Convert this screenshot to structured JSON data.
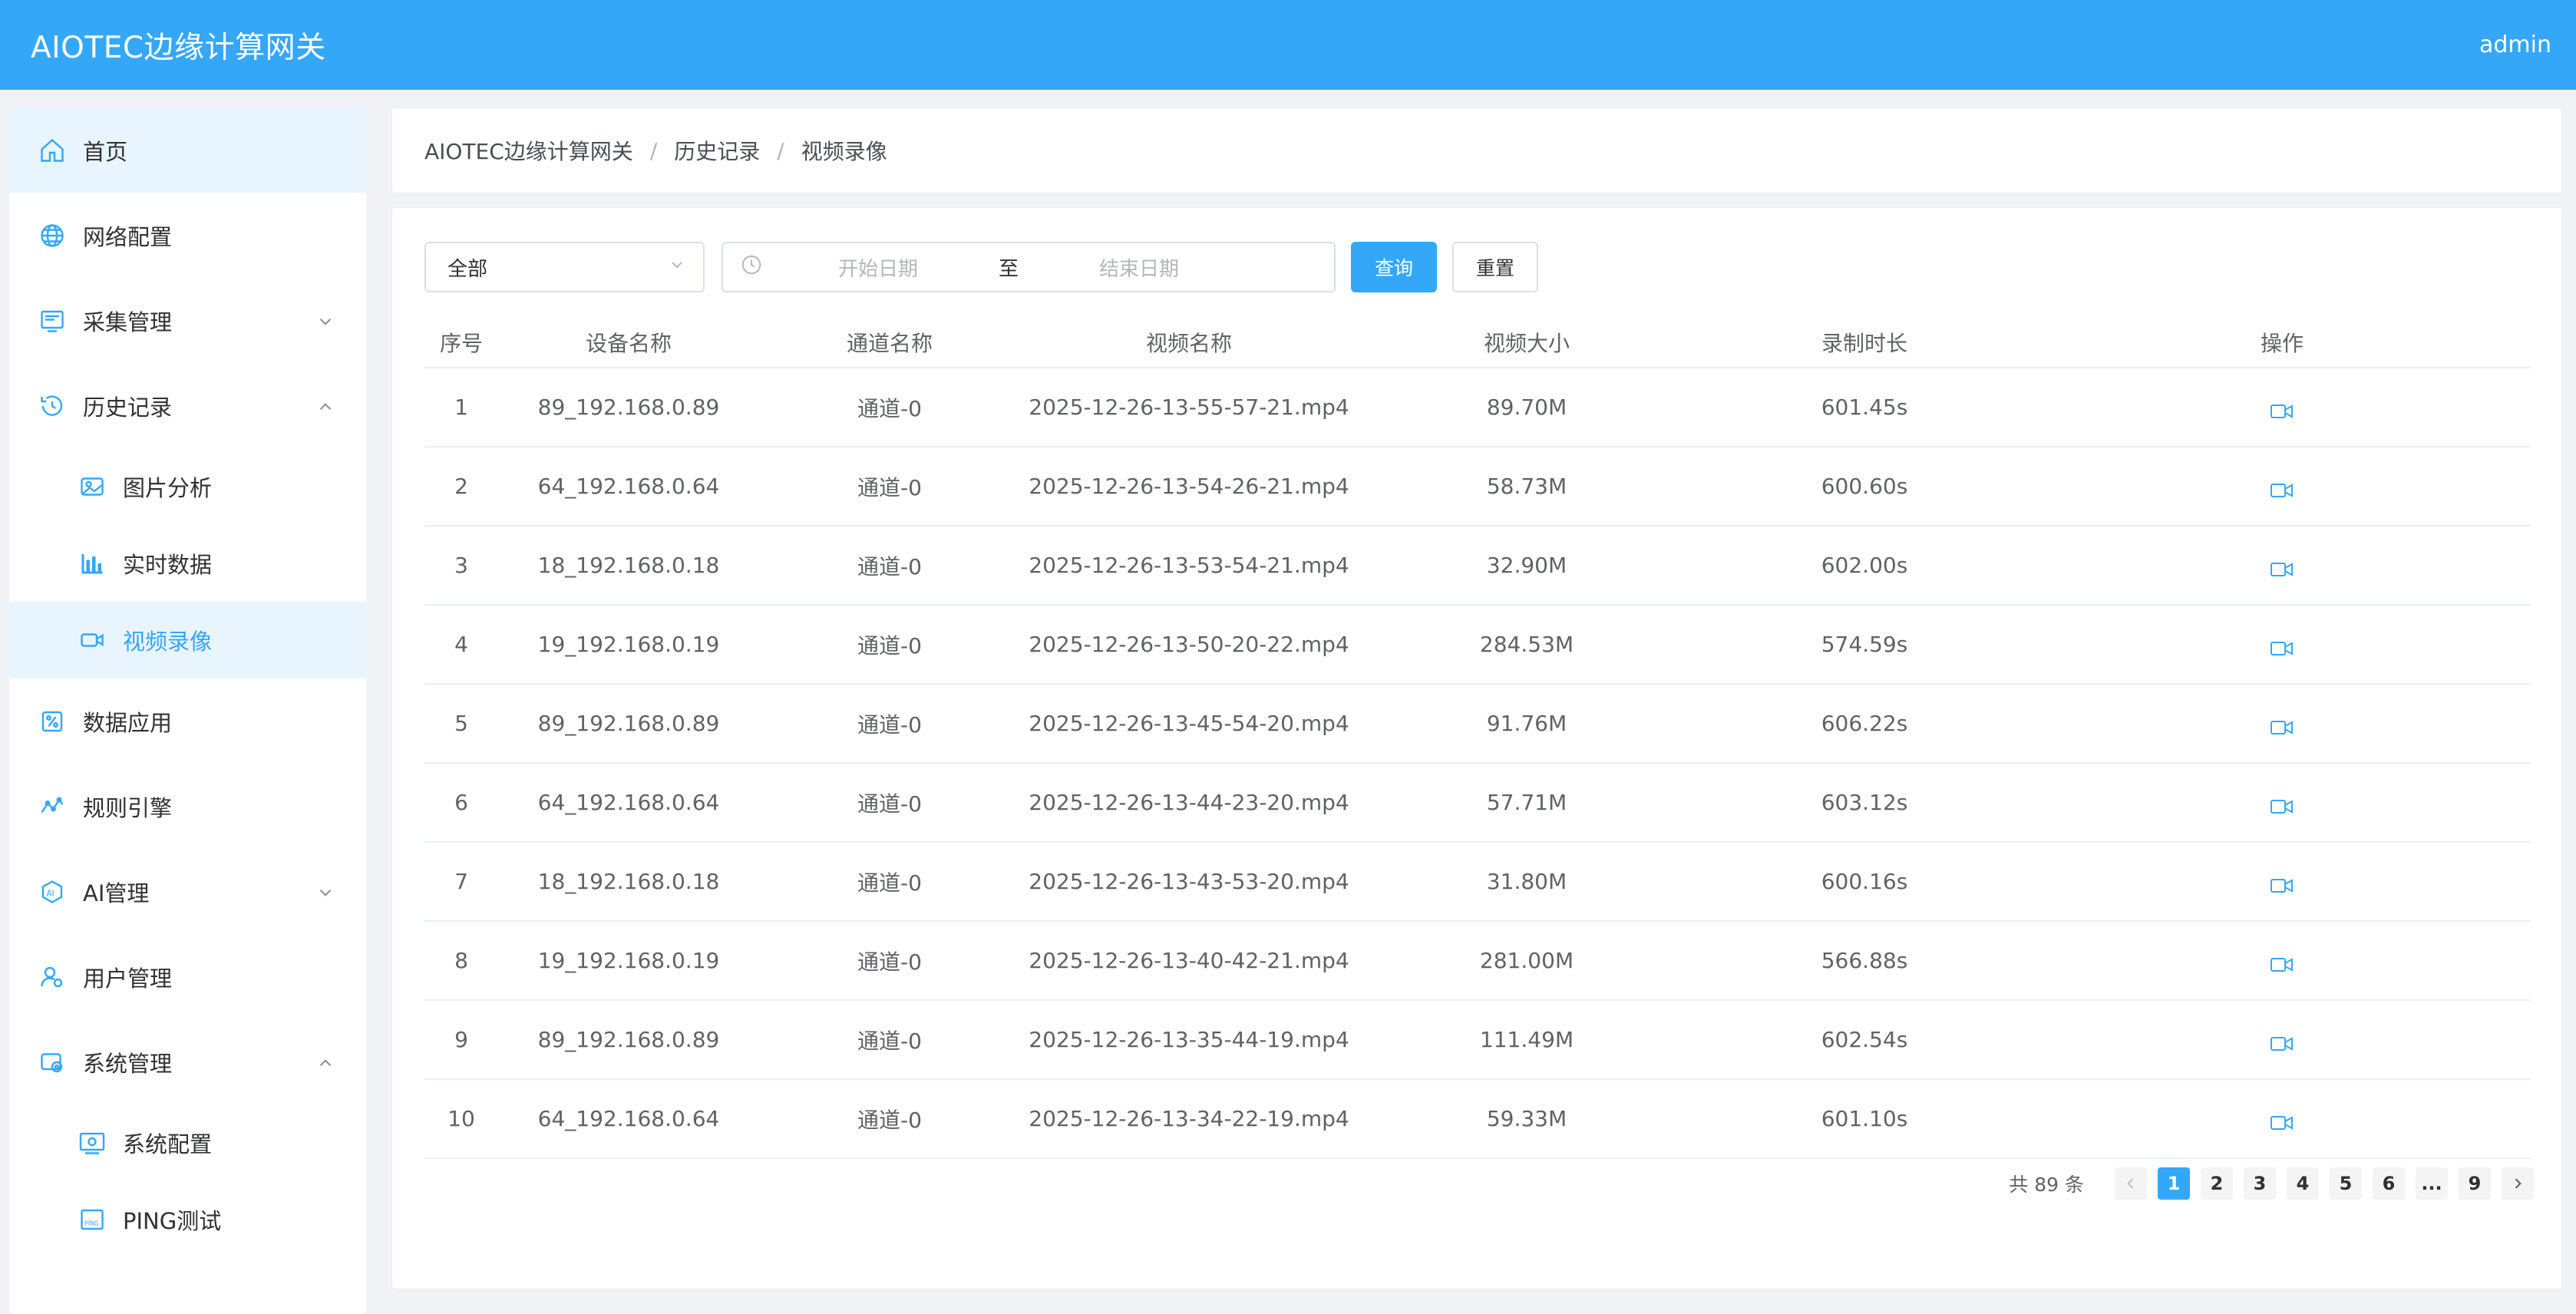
{
  "header": {
    "title": "AIOTEC边缘计算网关",
    "user": "admin"
  },
  "sidebar": {
    "items": [
      {
        "label": "首页",
        "icon": "home-icon"
      },
      {
        "label": "网络配置",
        "icon": "globe-icon"
      },
      {
        "label": "采集管理",
        "icon": "collect-icon"
      },
      {
        "label": "历史记录",
        "icon": "history-icon"
      },
      {
        "label": "图片分析",
        "icon": "image-icon"
      },
      {
        "label": "实时数据",
        "icon": "bar-chart-icon"
      },
      {
        "label": "视频录像",
        "icon": "video-icon"
      },
      {
        "label": "数据应用",
        "icon": "data-app-icon"
      },
      {
        "label": "规则引擎",
        "icon": "rule-icon"
      },
      {
        "label": "AI管理",
        "icon": "ai-icon"
      },
      {
        "label": "用户管理",
        "icon": "user-icon"
      },
      {
        "label": "系统管理",
        "icon": "system-icon"
      },
      {
        "label": "系统配置",
        "icon": "system-config-icon"
      },
      {
        "label": "PING测试",
        "icon": "ping-icon"
      }
    ]
  },
  "breadcrumb": [
    "AIOTEC边缘计算网关",
    "历史记录",
    "视频录像"
  ],
  "breadcrumb_sep": "/",
  "filters": {
    "select_value": "全部",
    "start_placeholder": "开始日期",
    "range_sep": "至",
    "end_placeholder": "结束日期",
    "query_label": "查询",
    "reset_label": "重置"
  },
  "table": {
    "columns": [
      "序号",
      "设备名称",
      "通道名称",
      "视频名称",
      "视频大小",
      "录制时长",
      "操作"
    ],
    "rows": [
      [
        "1",
        "89_192.168.0.89",
        "通道-0",
        "2025-12-26-13-55-57-21.mp4",
        "89.70M",
        "601.45s"
      ],
      [
        "2",
        "64_192.168.0.64",
        "通道-0",
        "2025-12-26-13-54-26-21.mp4",
        "58.73M",
        "600.60s"
      ],
      [
        "3",
        "18_192.168.0.18",
        "通道-0",
        "2025-12-26-13-53-54-21.mp4",
        "32.90M",
        "602.00s"
      ],
      [
        "4",
        "19_192.168.0.19",
        "通道-0",
        "2025-12-26-13-50-20-22.mp4",
        "284.53M",
        "574.59s"
      ],
      [
        "5",
        "89_192.168.0.89",
        "通道-0",
        "2025-12-26-13-45-54-20.mp4",
        "91.76M",
        "606.22s"
      ],
      [
        "6",
        "64_192.168.0.64",
        "通道-0",
        "2025-12-26-13-44-23-20.mp4",
        "57.71M",
        "603.12s"
      ],
      [
        "7",
        "18_192.168.0.18",
        "通道-0",
        "2025-12-26-13-43-53-20.mp4",
        "31.80M",
        "600.16s"
      ],
      [
        "8",
        "19_192.168.0.19",
        "通道-0",
        "2025-12-26-13-40-42-21.mp4",
        "281.00M",
        "566.88s"
      ],
      [
        "9",
        "89_192.168.0.89",
        "通道-0",
        "2025-12-26-13-35-44-19.mp4",
        "111.49M",
        "602.54s"
      ],
      [
        "10",
        "64_192.168.0.64",
        "通道-0",
        "2025-12-26-13-34-22-19.mp4",
        "59.33M",
        "601.10s"
      ]
    ]
  },
  "pagination": {
    "total_text": "共 89 条",
    "pages": [
      "1",
      "2",
      "3",
      "4",
      "5",
      "6",
      "...",
      "9"
    ],
    "current": "1"
  },
  "colors": {
    "accent": "#34a7f8",
    "active_bg": "#e8f4fe"
  }
}
